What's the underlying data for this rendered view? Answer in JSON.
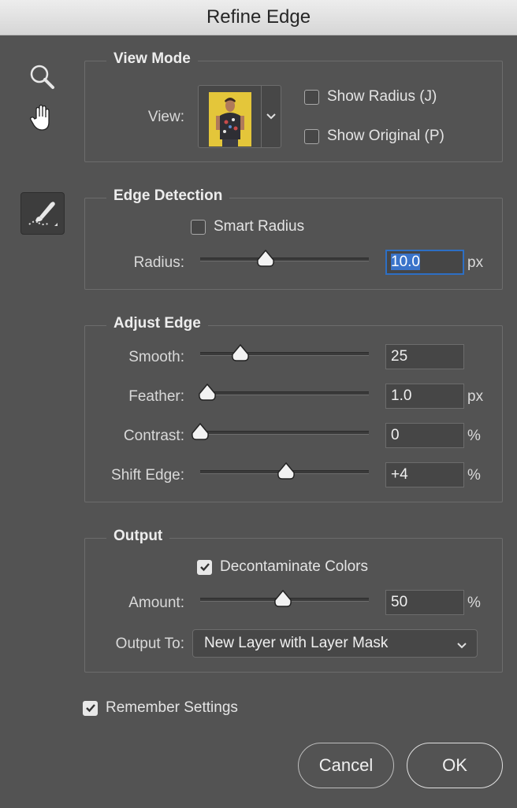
{
  "window": {
    "title": "Refine Edge"
  },
  "tools": {
    "zoom_icon": "magnifier-icon",
    "hand_icon": "hand-icon",
    "brush_icon": "refine-radius-brush-icon"
  },
  "view_mode": {
    "title": "View Mode",
    "view_label": "View:",
    "show_radius": {
      "label": "Show Radius (J)",
      "checked": false
    },
    "show_original": {
      "label": "Show Original (P)",
      "checked": false
    }
  },
  "edge_detection": {
    "title": "Edge Detection",
    "smart_radius": {
      "label": "Smart Radius",
      "checked": false
    },
    "radius": {
      "label": "Radius:",
      "value": "10.0",
      "unit": "px",
      "slider_fraction": 0.39
    }
  },
  "adjust_edge": {
    "title": "Adjust Edge",
    "smooth": {
      "label": "Smooth:",
      "value": "25",
      "unit": "",
      "slider_fraction": 0.24
    },
    "feather": {
      "label": "Feather:",
      "value": "1.0",
      "unit": "px",
      "slider_fraction": 0.04
    },
    "contrast": {
      "label": "Contrast:",
      "value": "0",
      "unit": "%",
      "slider_fraction": 0.0
    },
    "shift_edge": {
      "label": "Shift Edge:",
      "value": "+4",
      "unit": "%",
      "slider_fraction": 0.51
    }
  },
  "output": {
    "title": "Output",
    "decontaminate": {
      "label": "Decontaminate Colors",
      "checked": true
    },
    "amount": {
      "label": "Amount:",
      "value": "50",
      "unit": "%",
      "slider_fraction": 0.49
    },
    "output_to_label": "Output To:",
    "output_to_value": "New Layer with Layer Mask"
  },
  "remember_settings": {
    "label": "Remember Settings",
    "checked": true
  },
  "buttons": {
    "cancel": "Cancel",
    "ok": "OK"
  },
  "colors": {
    "background": "#535353",
    "accent": "#3a73c9"
  }
}
